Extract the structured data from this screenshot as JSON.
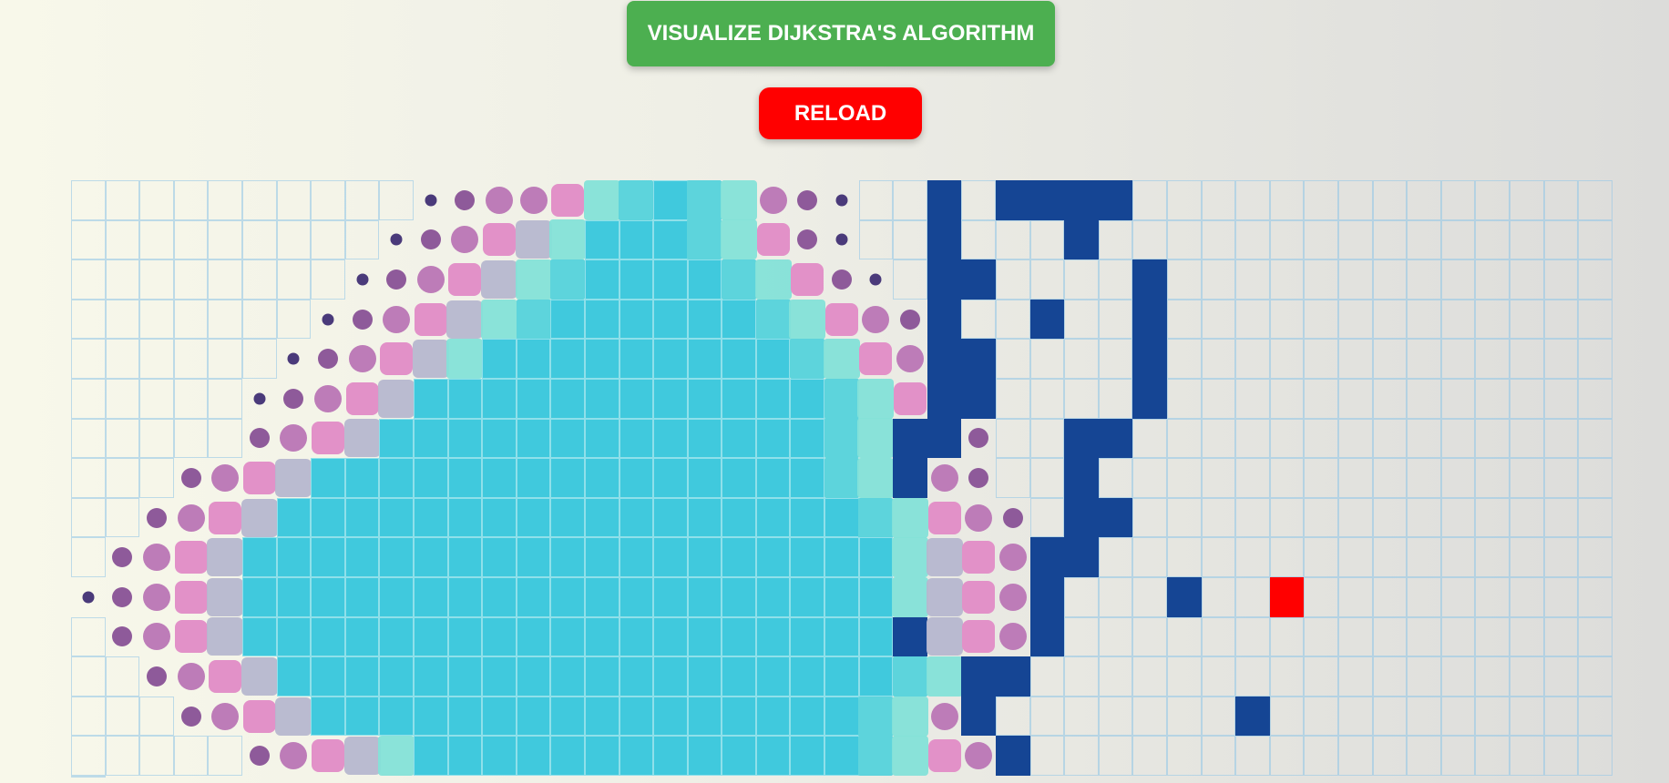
{
  "controls": {
    "visualize_label": "VISUALIZE DIJKSTRA'S ALGORITHM",
    "reload_label": "RELOAD"
  },
  "colors": {
    "visualize_button": "#4caf50",
    "reload_button": "#ff0000",
    "wall": "#154594",
    "target": "#ff0000",
    "visited": "#40c9dd"
  },
  "grid": {
    "rows": 15,
    "cols": 45,
    "legend": {
      ".": "unvisited",
      "#": "wall",
      "T": "target",
      "V": "visited",
      "1": "animating-dot-small",
      "2": "animating-dot-medium",
      "3": "animating-dot-large",
      "4": "animating-pink-square",
      "5": "animating-gray-square",
      "6": "animating-mint-square",
      "7": "animating-cyan-square"
    },
    "map": [
      "..........1233467V76321..#.####..............",
      ".........123456VVV76421..#...#...............",
      "........1234567VVVV76421.##....#.............",
      ".......1234567VVVVVV76432#..#..#.............",
      "......123456VVVVVVVVV7643##....#.............",
      ".....12345VVVVVVVVVVVV764##....#.............",
      ".....2345VVVVVVVVVVVVV76##2..##.............",
      "....2345VVVVVVVVVVVVVVV76#32..#..............",
      "...2345VVVVVVVVVVVVVVVVV76432.##.............",
      "..2345VVVVVVVVVVVVVVVVVVV6543##..............",
      ".12345VVVVVVVVVVVVVVVVVVV6543#...#..T........",
      "..2345VVVVVVVVVVVVVVVVVVV#543#...............",
      "...2345VVVVVVVVVVVVVVVVVV76##................",
      "....2345VVVVVVVVVVVVVVVV763#.......#..........",
      ".....23456VVVVVVVVVVVVV7643#.................."
    ]
  }
}
